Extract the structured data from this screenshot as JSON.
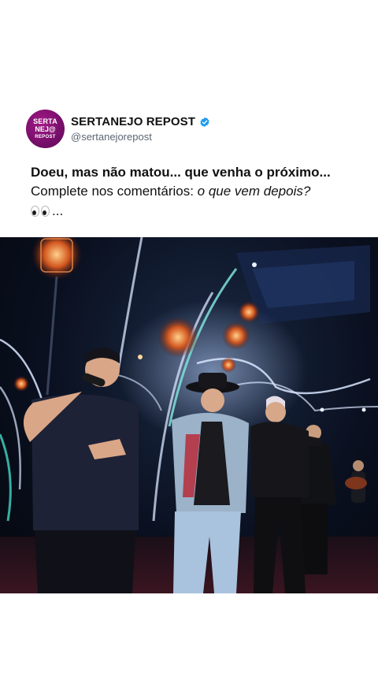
{
  "account": {
    "avatar_text": [
      "SERTA",
      "NEJ@",
      "REPOST"
    ],
    "display_name": "SERTANEJO REPOST",
    "handle": "@sertanejorepost",
    "verified": true
  },
  "post": {
    "line1": "Doeu, mas não matou... que venha o próximo...",
    "line2_plain": "Complete nos comentários: ",
    "line2_italic": "o que vem depois?",
    "line3_emoji": "eyes-emoji",
    "line3_text": "..."
  },
  "media": {
    "kind": "concert-stage-photo"
  },
  "colors": {
    "avatar": "#7a0f6c",
    "verified": "#1d9bf0",
    "text": "#111111",
    "handle": "#5b6672"
  }
}
